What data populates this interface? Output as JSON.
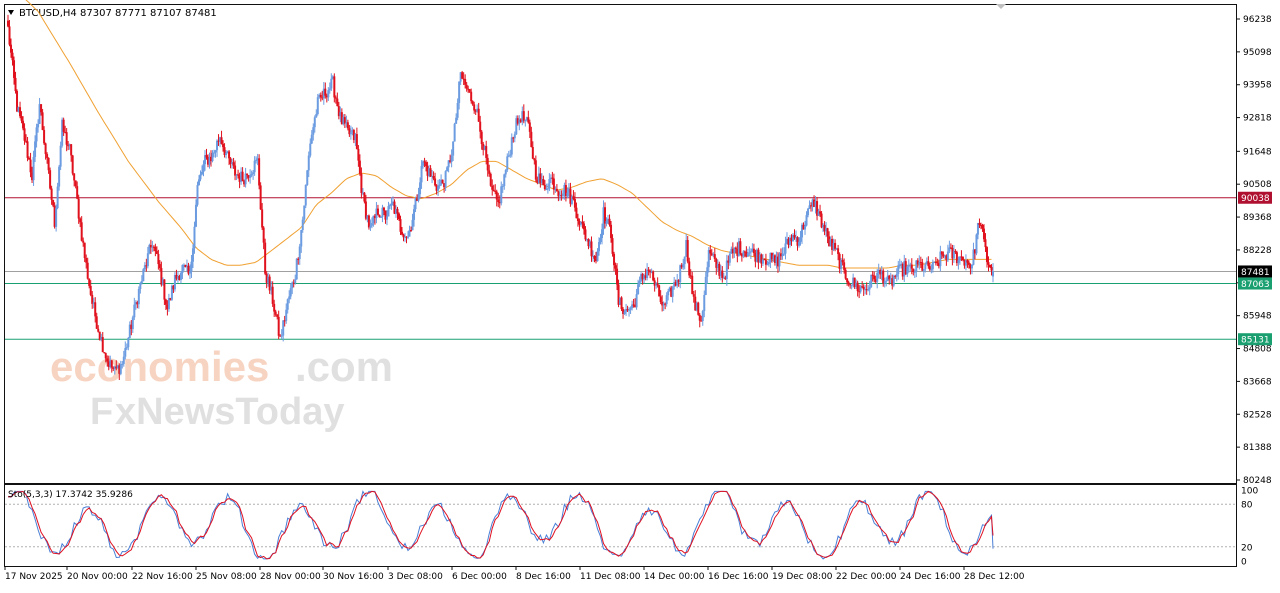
{
  "header": {
    "symbol": "BTCUSD,H4",
    "ohlc": "87307 87771 87107 87481"
  },
  "watermark": {
    "brand_part1": "economies",
    "brand_part2": ".com",
    "brand_line2_a": "F",
    "brand_line2_b": "xNewsToday"
  },
  "colors": {
    "bull": "#6b9be0",
    "bear": "#e0101c",
    "ma": "#f0a030",
    "resistance": "#b01030",
    "support": "#1aa070",
    "current": "#a0a0a0",
    "stoch_k": "#4a7fd6",
    "stoch_d": "#e01020"
  },
  "chart_data": {
    "type": "candlestick",
    "y_axis_ticks": [
      "96238",
      "95098",
      "93958",
      "92818",
      "91648",
      "90508",
      "89368",
      "88228",
      "87088",
      "85948",
      "84808",
      "83668",
      "82528",
      "81388",
      "80248"
    ],
    "ylim": [
      80248,
      96238
    ],
    "x_axis_ticks": [
      "17 Nov 2025",
      "20 Nov 00:00",
      "22 Nov 16:00",
      "25 Nov 08:00",
      "28 Nov 00:00",
      "30 Nov 16:00",
      "3 Dec 08:00",
      "6 Dec 00:00",
      "8 Dec 16:00",
      "11 Dec 08:00",
      "14 Dec 00:00",
      "16 Dec 16:00",
      "19 Dec 08:00",
      "22 Dec 00:00",
      "24 Dec 16:00",
      "28 Dec 12:00"
    ],
    "price_labels": {
      "resistance": "90038",
      "current": "87481",
      "support1": "87063",
      "support2": "85131"
    },
    "levels": {
      "resistance": 90038,
      "current": 87481,
      "support1": 87063,
      "support2": 85131
    },
    "last_candle": {
      "open": 87307,
      "high": 87771,
      "low": 87107,
      "close": 87481
    },
    "close_path": [
      [
        0,
        95900
      ],
      [
        6,
        93200
      ],
      [
        11,
        92100
      ],
      [
        16,
        90800
      ],
      [
        21,
        93300
      ],
      [
        26,
        91200
      ],
      [
        31,
        89200
      ],
      [
        36,
        92500
      ],
      [
        41,
        91700
      ],
      [
        46,
        89900
      ],
      [
        51,
        88000
      ],
      [
        56,
        86400
      ],
      [
        61,
        85300
      ],
      [
        66,
        84400
      ],
      [
        71,
        84000
      ],
      [
        76,
        84300
      ],
      [
        81,
        85400
      ],
      [
        86,
        86600
      ],
      [
        91,
        87600
      ],
      [
        96,
        88500
      ],
      [
        101,
        87500
      ],
      [
        106,
        86200
      ],
      [
        111,
        87200
      ],
      [
        116,
        87600
      ],
      [
        121,
        87300
      ],
      [
        126,
        90400
      ],
      [
        131,
        91300
      ],
      [
        136,
        91500
      ],
      [
        141,
        92200
      ],
      [
        146,
        91400
      ],
      [
        151,
        90900
      ],
      [
        156,
        90700
      ],
      [
        161,
        91000
      ],
      [
        166,
        91300
      ],
      [
        171,
        87500
      ],
      [
        176,
        86500
      ],
      [
        181,
        85100
      ],
      [
        186,
        86400
      ],
      [
        191,
        87400
      ],
      [
        196,
        89300
      ],
      [
        201,
        92000
      ],
      [
        206,
        93300
      ],
      [
        211,
        93700
      ],
      [
        216,
        94000
      ],
      [
        221,
        92800
      ],
      [
        226,
        92300
      ],
      [
        231,
        92100
      ],
      [
        236,
        90000
      ],
      [
        241,
        88900
      ],
      [
        246,
        89600
      ],
      [
        251,
        89400
      ],
      [
        256,
        89800
      ],
      [
        261,
        89000
      ],
      [
        266,
        88700
      ],
      [
        271,
        89800
      ],
      [
        276,
        91300
      ],
      [
        281,
        90800
      ],
      [
        286,
        90400
      ],
      [
        291,
        90700
      ],
      [
        296,
        91900
      ],
      [
        301,
        94300
      ],
      [
        306,
        93700
      ],
      [
        311,
        93200
      ],
      [
        316,
        91900
      ],
      [
        321,
        90300
      ],
      [
        326,
        89800
      ],
      [
        331,
        91000
      ],
      [
        336,
        92300
      ],
      [
        341,
        92900
      ],
      [
        346,
        92500
      ],
      [
        351,
        90900
      ],
      [
        356,
        90400
      ],
      [
        361,
        90700
      ],
      [
        366,
        90300
      ],
      [
        371,
        90300
      ],
      [
        376,
        89900
      ],
      [
        381,
        89100
      ],
      [
        386,
        88500
      ],
      [
        391,
        87900
      ],
      [
        396,
        89500
      ],
      [
        401,
        88800
      ],
      [
        406,
        86400
      ],
      [
        411,
        86100
      ],
      [
        416,
        86300
      ],
      [
        421,
        87200
      ],
      [
        426,
        87600
      ],
      [
        431,
        86900
      ],
      [
        436,
        86200
      ],
      [
        441,
        86800
      ],
      [
        446,
        87300
      ],
      [
        451,
        88400
      ],
      [
        456,
        86400
      ],
      [
        461,
        85800
      ],
      [
        466,
        88100
      ],
      [
        471,
        87700
      ],
      [
        476,
        87300
      ],
      [
        481,
        88100
      ],
      [
        486,
        88300
      ],
      [
        491,
        88200
      ],
      [
        496,
        88100
      ],
      [
        501,
        88000
      ],
      [
        506,
        87900
      ],
      [
        511,
        87800
      ],
      [
        516,
        88200
      ],
      [
        521,
        88700
      ],
      [
        526,
        88600
      ],
      [
        531,
        89400
      ],
      [
        536,
        89900
      ],
      [
        541,
        89200
      ],
      [
        546,
        88500
      ],
      [
        551,
        88100
      ],
      [
        556,
        87400
      ],
      [
        561,
        87100
      ],
      [
        566,
        86900
      ],
      [
        571,
        86900
      ],
      [
        576,
        87300
      ],
      [
        581,
        87400
      ],
      [
        586,
        87000
      ],
      [
        591,
        87400
      ],
      [
        596,
        87600
      ],
      [
        601,
        87500
      ],
      [
        606,
        87700
      ],
      [
        611,
        87600
      ],
      [
        616,
        87600
      ],
      [
        621,
        88000
      ],
      [
        626,
        88100
      ],
      [
        631,
        88000
      ],
      [
        636,
        87900
      ],
      [
        641,
        87700
      ],
      [
        646,
        89300
      ],
      [
        651,
        87900
      ],
      [
        655,
        87481
      ]
    ],
    "ma_path": [
      [
        0,
        97500
      ],
      [
        20,
        96500
      ],
      [
        40,
        94800
      ],
      [
        60,
        93000
      ],
      [
        80,
        91300
      ],
      [
        100,
        89900
      ],
      [
        115,
        89000
      ],
      [
        125,
        88300
      ],
      [
        135,
        87900
      ],
      [
        145,
        87700
      ],
      [
        155,
        87700
      ],
      [
        165,
        87800
      ],
      [
        175,
        88200
      ],
      [
        185,
        88600
      ],
      [
        195,
        89000
      ],
      [
        205,
        89800
      ],
      [
        215,
        90200
      ],
      [
        225,
        90700
      ],
      [
        235,
        90900
      ],
      [
        245,
        90800
      ],
      [
        255,
        90400
      ],
      [
        265,
        90100
      ],
      [
        275,
        90000
      ],
      [
        285,
        90200
      ],
      [
        295,
        90500
      ],
      [
        305,
        91000
      ],
      [
        315,
        91300
      ],
      [
        325,
        91300
      ],
      [
        335,
        91000
      ],
      [
        345,
        90700
      ],
      [
        355,
        90500
      ],
      [
        365,
        90300
      ],
      [
        375,
        90400
      ],
      [
        385,
        90600
      ],
      [
        395,
        90700
      ],
      [
        405,
        90500
      ],
      [
        415,
        90200
      ],
      [
        425,
        89700
      ],
      [
        435,
        89200
      ],
      [
        445,
        88900
      ],
      [
        455,
        88700
      ],
      [
        465,
        88400
      ],
      [
        475,
        88200
      ],
      [
        485,
        88100
      ],
      [
        495,
        88000
      ],
      [
        505,
        87900
      ],
      [
        515,
        87800
      ],
      [
        525,
        87700
      ],
      [
        535,
        87700
      ],
      [
        545,
        87700
      ],
      [
        555,
        87600
      ],
      [
        565,
        87600
      ],
      [
        575,
        87600
      ],
      [
        585,
        87600
      ],
      [
        595,
        87700
      ],
      [
        605,
        87700
      ],
      [
        615,
        87800
      ],
      [
        625,
        87900
      ],
      [
        635,
        87900
      ],
      [
        645,
        87900
      ],
      [
        655,
        87900
      ]
    ],
    "stochastic": {
      "label": "Sto(5,3,3) 17.3742 35.9286",
      "k": 17.3742,
      "d": 35.9286,
      "ylim": [
        0,
        100
      ],
      "levels": [
        80,
        20
      ],
      "scale_labels": [
        "100",
        "80",
        "20",
        "0"
      ]
    }
  }
}
